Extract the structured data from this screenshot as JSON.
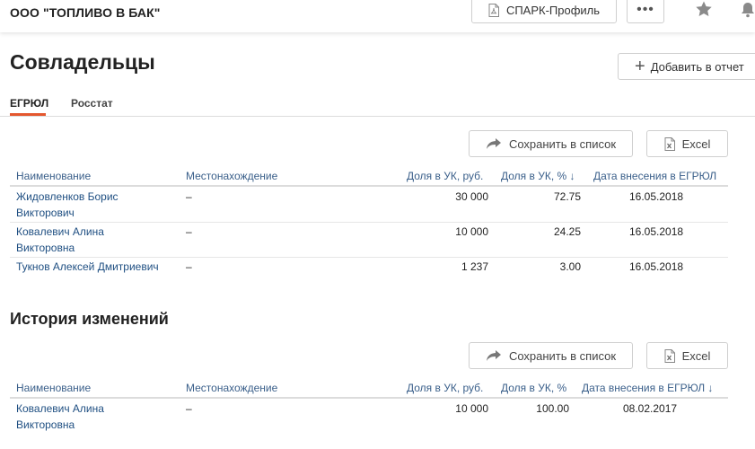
{
  "header": {
    "company": "ООО \"ТОПЛИВО В БАК\"",
    "spark_label": "СПАРК-Профиль",
    "more_label": "•••"
  },
  "owners": {
    "title": "Совладельцы",
    "add_label": "Добавить в отчет",
    "tabs": [
      {
        "label": "ЕГРЮЛ"
      },
      {
        "label": "Росстат"
      }
    ],
    "save_label": "Сохранить в список",
    "excel_label": "Excel",
    "columns": {
      "name": "Наименование",
      "location": "Местонахождение",
      "share_rub": "Доля в УК, руб.",
      "share_pct": "Доля в УК, % ↓",
      "date": "Дата внесения в ЕГРЮЛ"
    },
    "rows": [
      {
        "name_1": "Жидовленков Борис",
        "name_2": "Викторович",
        "location": "–",
        "share_rub": "30 000",
        "share_pct": "72.75",
        "date": "16.05.2018"
      },
      {
        "name_1": "Ковалевич Алина",
        "name_2": "Викторовна",
        "location": "–",
        "share_rub": "10 000",
        "share_pct": "24.25",
        "date": "16.05.2018"
      },
      {
        "name_1": "Тукнов Алексей Дмитриевич",
        "name_2": "",
        "location": "–",
        "share_rub": "1 237",
        "share_pct": "3.00",
        "date": "16.05.2018"
      }
    ]
  },
  "history": {
    "title": "История изменений",
    "save_label": "Сохранить в список",
    "excel_label": "Excel",
    "columns": {
      "name": "Наименование",
      "location": "Местонахождение",
      "share_rub": "Доля в УК, руб.",
      "share_pct": "Доля в УК, %",
      "date": "Дата внесения в ЕГРЮЛ ↓"
    },
    "rows": [
      {
        "name_1": "Ковалевич Алина",
        "name_2": "Викторовна",
        "location": "–",
        "share_rub": "10 000",
        "share_pct": "100.00",
        "date": "08.02.2017"
      }
    ]
  },
  "colors": {
    "accent": "#e4572e",
    "link": "#1f4f82",
    "header_text": "#3a5f8a"
  }
}
